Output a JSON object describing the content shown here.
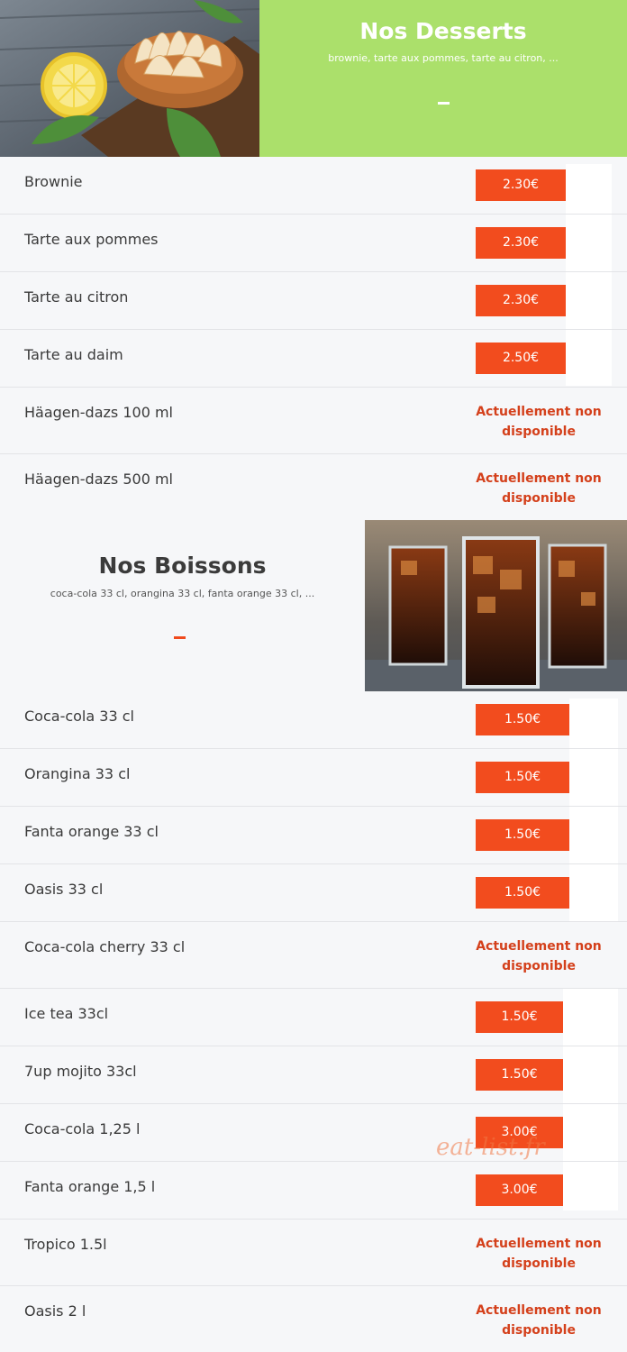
{
  "desserts": {
    "title": "Nos Desserts",
    "subtitle": "brownie, tarte aux pommes, tarte au citron, ...",
    "items": [
      {
        "name": "Brownie",
        "price": "2.30€"
      },
      {
        "name": "Tarte aux pommes",
        "price": "2.30€"
      },
      {
        "name": "Tarte au citron",
        "price": "2.30€"
      },
      {
        "name": "Tarte au daim",
        "price": "2.50€"
      },
      {
        "name": "Häagen-dazs 100 ml",
        "unavailable_line1": "Actuellement non",
        "unavailable_line2": "disponible"
      },
      {
        "name": "Häagen-dazs 500 ml",
        "unavailable_line1": "Actuellement non",
        "unavailable_line2": "disponible"
      }
    ]
  },
  "boissons": {
    "title": "Nos Boissons",
    "subtitle": "coca-cola 33 cl, orangina 33 cl, fanta orange 33 cl, ...",
    "items": [
      {
        "name": "Coca-cola 33 cl",
        "price": "1.50€"
      },
      {
        "name": "Orangina 33 cl",
        "price": "1.50€"
      },
      {
        "name": "Fanta orange 33 cl",
        "price": "1.50€"
      },
      {
        "name": "Oasis 33 cl",
        "price": "1.50€"
      },
      {
        "name": "Coca-cola cherry 33 cl",
        "unavailable_line1": "Actuellement non",
        "unavailable_line2": "disponible"
      },
      {
        "name": "Ice tea 33cl",
        "price": "1.50€"
      },
      {
        "name": "7up mojito 33cl",
        "price": "1.50€"
      },
      {
        "name": "Coca-cola 1,25 l",
        "price": "3.00€"
      },
      {
        "name": "Fanta orange 1,5 l",
        "price": "3.00€"
      },
      {
        "name": "Tropico 1.5l",
        "unavailable_line1": "Actuellement non",
        "unavailable_line2": "disponible"
      },
      {
        "name": "Oasis 2 l",
        "unavailable_line1": "Actuellement non",
        "unavailable_line2": "disponible"
      }
    ]
  },
  "watermark": "eat-list.fr",
  "colors": {
    "accent_green": "#abe06b",
    "price_orange": "#f24c1e",
    "unavailable_red": "#d4401b"
  }
}
